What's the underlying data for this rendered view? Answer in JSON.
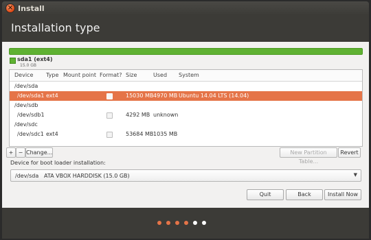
{
  "window": {
    "title": "Install",
    "close_glyph": "×"
  },
  "header": {
    "title": "Installation type"
  },
  "partition_bar": {
    "color": "#5fb132",
    "legend": {
      "name": "sda1 (ext4)",
      "size": "15.0 GB"
    }
  },
  "table": {
    "columns": [
      "Device",
      "Type",
      "Mount point",
      "Format?",
      "Size",
      "Used",
      "System"
    ],
    "rows": [
      {
        "device": "/dev/sda",
        "type": "",
        "mount": "",
        "format": false,
        "has_format": false,
        "size": "",
        "used": "",
        "system": "",
        "selected": false,
        "indent": false
      },
      {
        "device": "/dev/sda1",
        "type": "ext4",
        "mount": "",
        "format": false,
        "has_format": true,
        "size": "15030 MB",
        "used": "4970 MB",
        "system": "Ubuntu 14.04 LTS (14.04)",
        "selected": true,
        "indent": true
      },
      {
        "device": "/dev/sdb",
        "type": "",
        "mount": "",
        "format": false,
        "has_format": false,
        "size": "",
        "used": "",
        "system": "",
        "selected": false,
        "indent": false
      },
      {
        "device": "/dev/sdb1",
        "type": "",
        "mount": "",
        "format": false,
        "has_format": true,
        "size": "4292 MB",
        "used": "unknown",
        "system": "",
        "selected": false,
        "indent": true
      },
      {
        "device": "/dev/sdc",
        "type": "",
        "mount": "",
        "format": false,
        "has_format": false,
        "size": "",
        "used": "",
        "system": "",
        "selected": false,
        "indent": false
      },
      {
        "device": "/dev/sdc1",
        "type": "ext4",
        "mount": "",
        "format": false,
        "has_format": true,
        "size": "53684 MB",
        "used": "1035 MB",
        "system": "",
        "selected": false,
        "indent": true
      }
    ]
  },
  "toolbar": {
    "add_label": "+",
    "remove_label": "−",
    "change_label": "Change...",
    "new_table_label": "New Partition Table...",
    "revert_label": "Revert"
  },
  "boot_loader": {
    "label": "Device for boot loader installation:",
    "device": "/dev/sda",
    "description": "ATA VBOX HARDDISK (15.0 GB)"
  },
  "buttons": {
    "quit": "Quit",
    "back": "Back",
    "install": "Install Now"
  },
  "progress_dots": {
    "total": 6,
    "completed": 4,
    "done_color": "#e57448",
    "todo_color": "#ffffff"
  },
  "colors": {
    "accent": "#e57448",
    "window_bg": "#3c3b37",
    "content_bg": "#f2f1f0"
  }
}
